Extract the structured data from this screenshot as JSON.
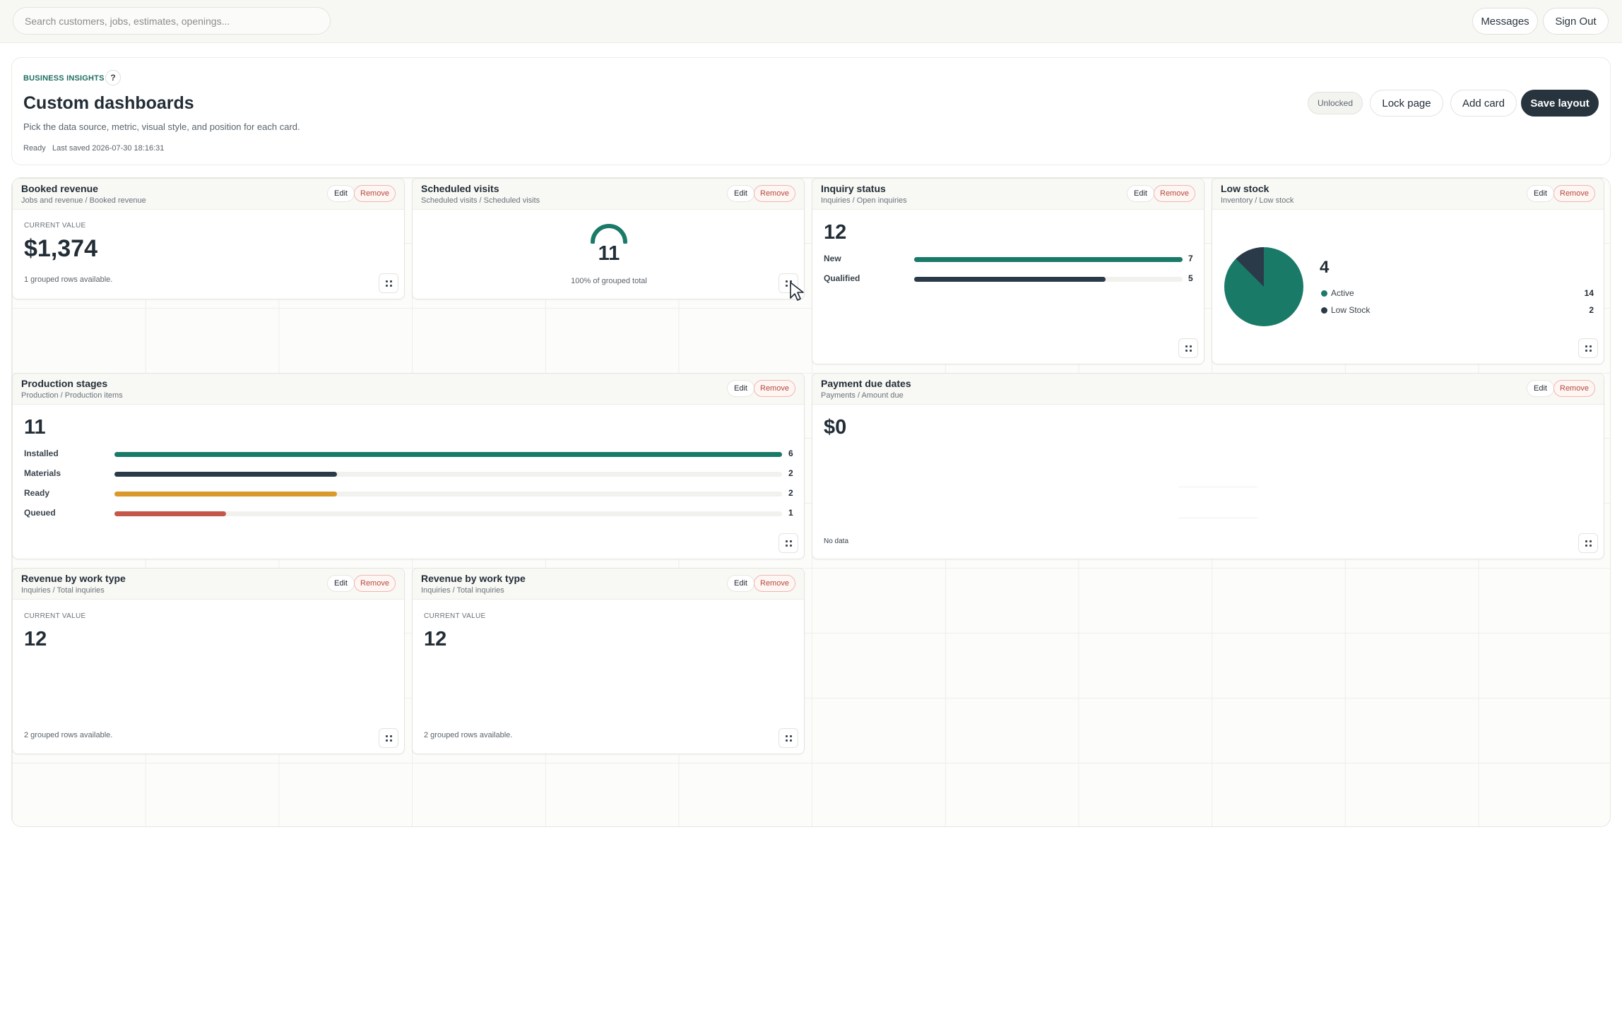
{
  "topbar": {
    "search_placeholder": "Search customers, jobs, estimates, openings...",
    "messages_label": "Messages",
    "signout_label": "Sign Out"
  },
  "header": {
    "eyebrow": "BUSINESS INSIGHTS",
    "help_label": "?",
    "title": "Custom dashboards",
    "subtitle": "Pick the data source, metric, visual style, and position for each card.",
    "status": "Ready   Last saved 2026-07-30 18:16:31",
    "unlocked_label": "Unlocked",
    "lock_label": "Lock page",
    "add_label": "Add card",
    "save_label": "Save layout"
  },
  "colors": {
    "teal": "#1a7a68",
    "navy": "#2b3a48",
    "amber": "#d99a2b",
    "red": "#c4574a"
  },
  "common": {
    "edit": "Edit",
    "remove": "Remove",
    "current_value": "CURRENT VALUE"
  },
  "cards": {
    "booked": {
      "title": "Booked revenue",
      "sub": "Jobs and revenue / Booked revenue",
      "value": "$1,374",
      "foot": "1 grouped rows available."
    },
    "visits": {
      "title": "Scheduled visits",
      "sub": "Scheduled visits / Scheduled visits",
      "value": "11",
      "foot": "100% of grouped total",
      "gauge_fraction": 1.0
    },
    "inquiry": {
      "title": "Inquiry status",
      "sub": "Inquiries / Open inquiries",
      "value": "12",
      "rows": [
        {
          "label": "New",
          "value": "7",
          "fraction": 1.0
        },
        {
          "label": "Qualified",
          "value": "5",
          "fraction": 0.714
        }
      ]
    },
    "lowstock": {
      "title": "Low stock",
      "sub": "Inventory / Low stock",
      "value": "4",
      "legend": [
        {
          "label": "Active",
          "value": "14"
        },
        {
          "label": "Low Stock",
          "value": "2"
        }
      ]
    },
    "production": {
      "title": "Production stages",
      "sub": "Production / Production items",
      "value": "11",
      "rows": [
        {
          "label": "Installed",
          "value": "6",
          "fraction": 1.0
        },
        {
          "label": "Materials",
          "value": "2",
          "fraction": 0.333
        },
        {
          "label": "Ready",
          "value": "2",
          "fraction": 0.333
        },
        {
          "label": "Queued",
          "value": "1",
          "fraction": 0.167
        }
      ]
    },
    "payment": {
      "title": "Payment due dates",
      "sub": "Payments / Amount due",
      "value": "$0",
      "foot": "No data"
    },
    "rev1": {
      "title": "Revenue by work type",
      "sub": "Inquiries / Total inquiries",
      "value": "12",
      "foot": "2 grouped rows available."
    },
    "rev2": {
      "title": "Revenue by work type",
      "sub": "Inquiries / Total inquiries",
      "value": "12",
      "foot": "2 grouped rows available."
    }
  }
}
